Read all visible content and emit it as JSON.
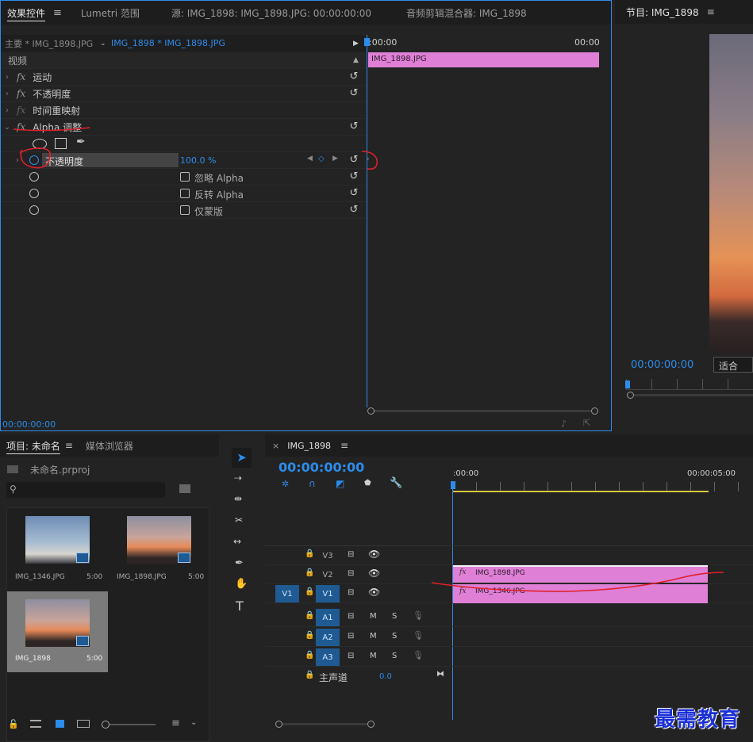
{
  "effect_controls": {
    "tabs": [
      "效果控件",
      "Lumetri 范围",
      "源: IMG_1898: IMG_1898.JPG: 00:00:00:00",
      "音频剪辑混合器: IMG_1898"
    ],
    "menu_glyph": "≡",
    "master_label": "主要 * IMG_1898.JPG",
    "clip_label": "IMG_1898 * IMG_1898.JPG",
    "time_start": ":00:00",
    "time_end": "00:00",
    "timeline_clip": "IMG_1898.JPG",
    "section_video": "视频",
    "effects": [
      "运动",
      "不透明度",
      "时间重映射",
      "Alpha 调整"
    ],
    "param_opacity_label": "不透明度",
    "param_opacity_value": "100.0 %",
    "options": [
      "忽略 Alpha",
      "反转 Alpha",
      "仅蒙版"
    ],
    "timecode": "00:00:00:00"
  },
  "program": {
    "title": "节目: IMG_1898",
    "timecode": "00:00:00:00",
    "fit": "适合"
  },
  "project": {
    "tabs": [
      "项目: 未命名",
      "媒体浏览器"
    ],
    "project_file": "未命名.prproj",
    "search_placeholder": "",
    "items": [
      {
        "name": "IMG_1346.JPG",
        "duration": "5:00"
      },
      {
        "name": "IMG_1898.JPG",
        "duration": "5:00"
      },
      {
        "name": "IMG_1898",
        "duration": "5:00"
      }
    ]
  },
  "timeline": {
    "tab": "IMG_1898",
    "timecode": "00:00:00:00",
    "ruler_start": ":00:00",
    "ruler_end": "00:00:05:00",
    "video_tracks": [
      "V3",
      "V2",
      "V1"
    ],
    "source_patch": "V1",
    "audio_tracks": [
      "A1",
      "A2",
      "A3"
    ],
    "master": "主声道",
    "master_value": "0.0",
    "clip_v2": "IMG_1898.JPG",
    "clip_v1": "IMG_1346.JPG",
    "mute": "M",
    "solo": "S"
  },
  "watermark": "最需教育",
  "colors": {
    "accent": "#2d8ceb",
    "clip": "#e07fd6",
    "annotation": "#e0202a"
  }
}
